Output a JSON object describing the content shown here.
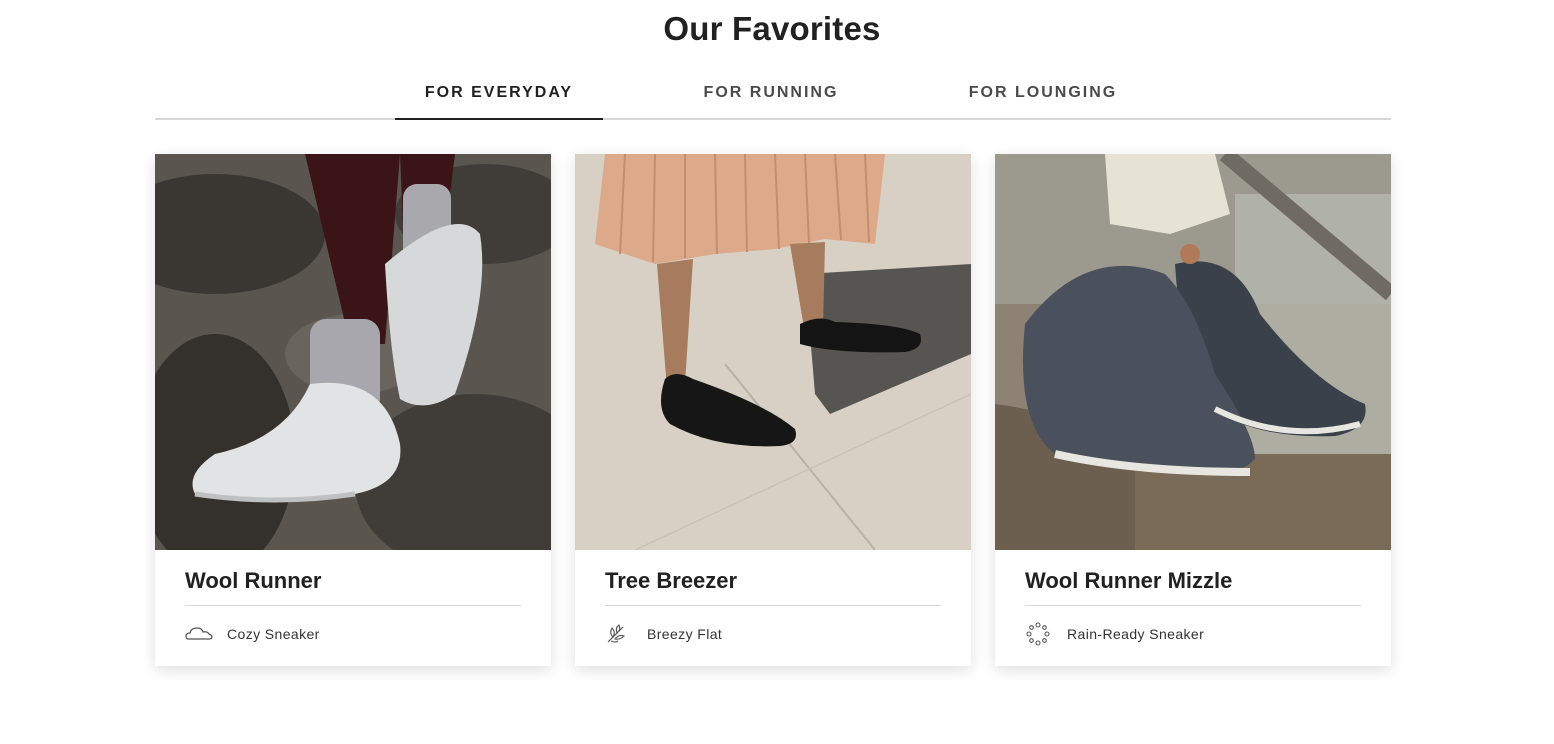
{
  "page": {
    "title": "Our Favorites"
  },
  "tabs": [
    {
      "label": "FOR EVERYDAY",
      "active": true
    },
    {
      "label": "FOR RUNNING",
      "active": false
    },
    {
      "label": "FOR LOUNGING",
      "active": false
    }
  ],
  "products": [
    {
      "name": "Wool Runner",
      "feature": "Cozy Sneaker",
      "icon": "cloud-icon"
    },
    {
      "name": "Tree Breezer",
      "feature": "Breezy Flat",
      "icon": "leaf-icon"
    },
    {
      "name": "Wool Runner Mizzle",
      "feature": "Rain-Ready Sneaker",
      "icon": "raindrops-icon"
    }
  ]
}
